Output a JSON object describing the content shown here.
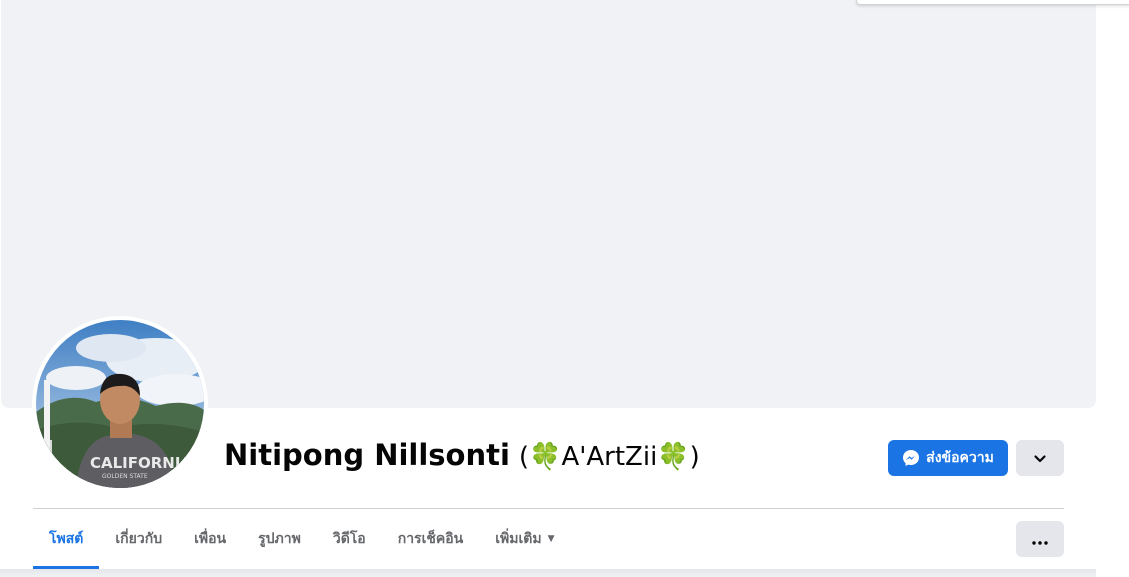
{
  "profile": {
    "name": "Nitipong Nillsonti",
    "alternate_name": "(🍀A'ArtZii🍀)"
  },
  "actions": {
    "message_label": "ส่งข้อความ",
    "message_icon": "messenger-icon",
    "dropdown_icon": "chevron-down-icon",
    "more_icon": "ellipsis-icon"
  },
  "tabs": [
    {
      "label": "โพสต์",
      "active": true
    },
    {
      "label": "เกี่ยวกับ",
      "active": false
    },
    {
      "label": "เพื่อน",
      "active": false
    },
    {
      "label": "รูปภาพ",
      "active": false
    },
    {
      "label": "วิดีโอ",
      "active": false
    },
    {
      "label": "การเช็คอิน",
      "active": false
    },
    {
      "label": "เพิ่มเติม",
      "active": false,
      "has_caret": true
    }
  ],
  "colors": {
    "accent": "#1b74e4",
    "cover": "#f0f2f5",
    "secondary_button": "#e4e6eb",
    "secondary_text": "#65676b"
  }
}
